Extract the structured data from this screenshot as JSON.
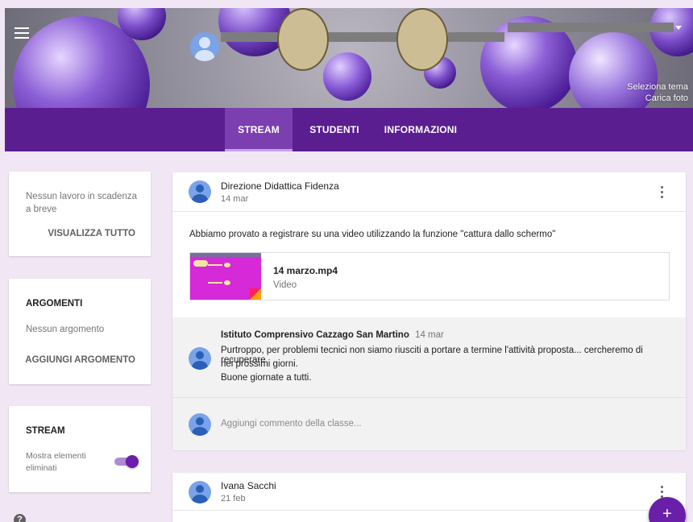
{
  "banner": {
    "select_theme": "Seleziona tema",
    "upload_photo": "Carica foto"
  },
  "tabs": [
    {
      "label": "STREAM",
      "active": true
    },
    {
      "label": "STUDENTI"
    },
    {
      "label": "INFORMAZIONI"
    }
  ],
  "upcoming": {
    "text": "Nessun lavoro in scadenza a breve",
    "action": "VISUALIZZA TUTTO"
  },
  "topics": {
    "title": "ARGOMENTI",
    "empty": "Nessun argomento",
    "action": "AGGIUNGI ARGOMENTO"
  },
  "stream_settings": {
    "title": "STREAM",
    "toggle_label": "Mostra elementi eliminati",
    "toggle_on": true
  },
  "posts": [
    {
      "author": "Direzione Didattica Fidenza",
      "date": "14 mar",
      "body": "Abbiamo provato a registrare su una video utilizzando la funzione \"cattura dallo schermo\"",
      "attachment": {
        "name": "14 marzo.mp4",
        "type": "Video"
      },
      "comments": [
        {
          "author": "Istituto Comprensivo Cazzago San Martino",
          "date": "14 mar",
          "lines": [
            "Purtroppo, per problemi tecnici non siamo riusciti a portare a termine l'attività proposta... cercheremo di recuperare",
            "nei prossimi giorni.",
            "Buone giornate a tutti."
          ]
        }
      ],
      "comment_placeholder": "Aggiungi commento della classe..."
    },
    {
      "author": "Ivana Sacchi",
      "date": "21 feb"
    }
  ],
  "fab_label": "+",
  "help_label": "?",
  "colors": {
    "primary": "#5a1e91",
    "accent": "#6a1fa9",
    "page_bg": "#f1e6f4"
  }
}
